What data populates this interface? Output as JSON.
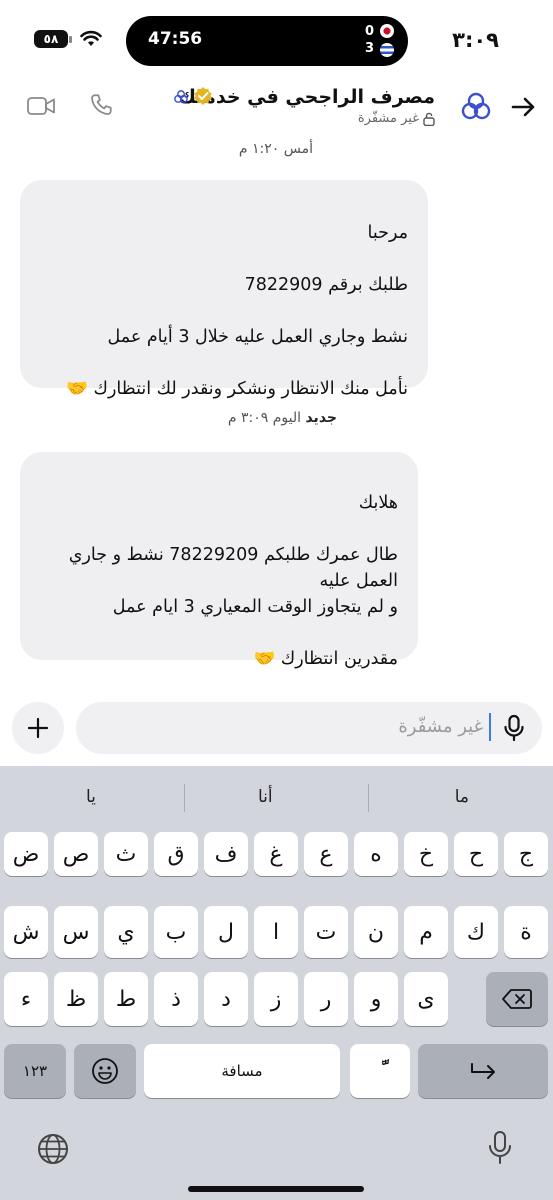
{
  "status_bar": {
    "time": "٣:٠٩",
    "battery": "٥٨",
    "live_activity": {
      "timer": "47:56",
      "score_top": "0",
      "score_bottom": "3"
    }
  },
  "header": {
    "title": "مصرف الراجحي في خدمتك",
    "subtitle": "غير مشفّرة",
    "accent_color": "#3d4fd1"
  },
  "messages": [
    {
      "timestamp": "أمس ١:٢٠ م",
      "text": "مرحبا\n\nطلبك برقم 7822909\n\nنشط وجاري العمل عليه خلال 3 أيام عمل\n\nنأمل منك الانتظار ونشكر ونقدر لك انتظارك 🤝"
    },
    {
      "timestamp_new": "جديد",
      "timestamp": "اليوم ٣:٠٩ م",
      "text": "هلابك\n\nطال عمرك طلبكم 78229209 نشط و جاري العمل عليه\nو لم يتجاوز الوقت المعياري 3 ايام عمل\n\nمقدرين انتظارك 🤝"
    }
  ],
  "compose": {
    "placeholder": "غير مشفّرة"
  },
  "keyboard": {
    "suggestions": [
      "ما",
      "أنا",
      "يا"
    ],
    "row1": [
      "ج",
      "ح",
      "خ",
      "ه",
      "ع",
      "غ",
      "ف",
      "ق",
      "ث",
      "ص",
      "ض"
    ],
    "row2": [
      "ة",
      "ك",
      "م",
      "ن",
      "ت",
      "ا",
      "ل",
      "ب",
      "ي",
      "س",
      "ش"
    ],
    "row3": [
      "ى",
      "و",
      "ر",
      "ز",
      "د",
      "ذ",
      "ط",
      "ظ",
      "ء"
    ],
    "numbers_key": "١٢٣",
    "space_key": "مسافة",
    "tashkeel_key": "ًّ"
  }
}
